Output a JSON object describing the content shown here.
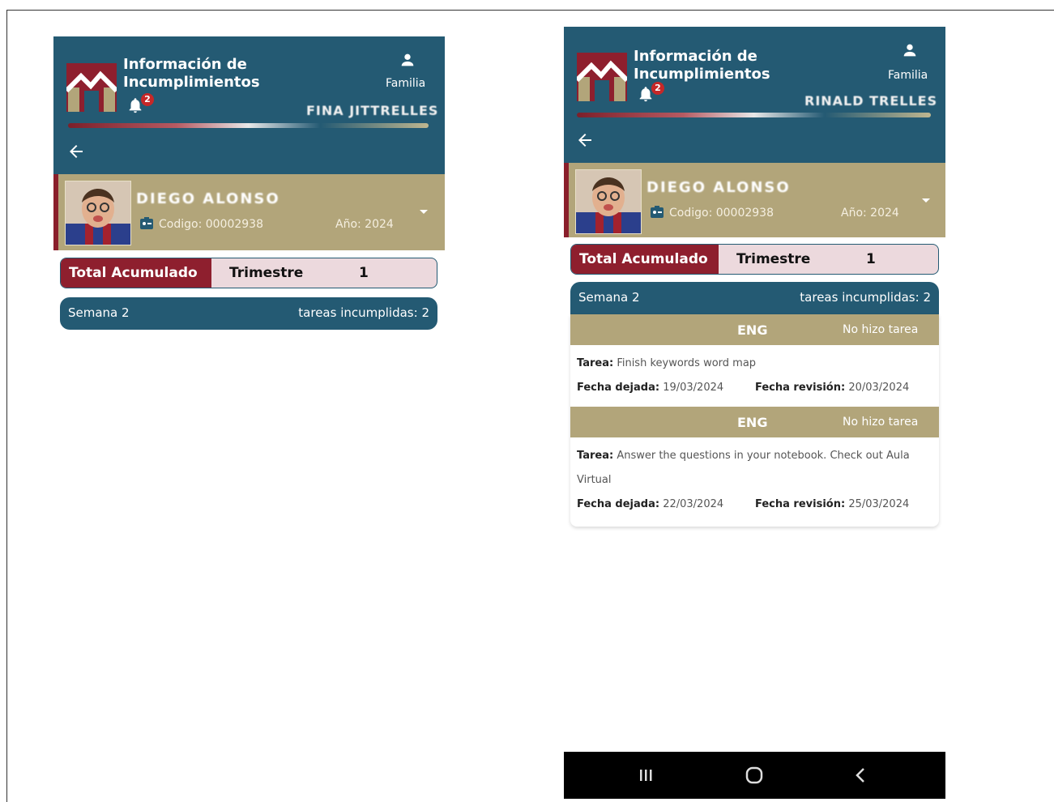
{
  "app": {
    "title": "Información de\nIncumplimientos",
    "notification_count": "2",
    "role": "Familia",
    "parent_name_left": "FINA JITTRELLES",
    "parent_name_right": "RINALD TRELLES"
  },
  "student": {
    "name": "DIEGO ALONSO",
    "code": "Codigo: 00002938",
    "year": "Año: 2024"
  },
  "tabs": {
    "total_label": "Total Acumulado",
    "period_label": "Trimestre",
    "period_value": "1"
  },
  "week": {
    "label": "Semana 2",
    "count_text": "tareas incumplidas: 2"
  },
  "tasks": [
    {
      "subject": "ENG",
      "status": "No hizo tarea",
      "task_label": "Tarea:",
      "task_text": "Finish keywords word map",
      "due_label": "Fecha dejada:",
      "due_date": "19/03/2024",
      "review_label": "Fecha revisión:",
      "review_date": "20/03/2024"
    },
    {
      "subject": "ENG",
      "status": "No hizo tarea",
      "task_label": "Tarea:",
      "task_text": "Answer the questions in your notebook. Check out Aula Virtual",
      "due_label": "Fecha dejada:",
      "due_date": "22/03/2024",
      "review_label": "Fecha revisión:",
      "review_date": "25/03/2024"
    }
  ],
  "colors": {
    "header": "#245a73",
    "student_band": "#b2a57a",
    "accent": "#8e1f2e",
    "tab_bg": "#ecd9dd"
  },
  "icons": {
    "logo": "school-logo-icon",
    "bell": "bell-icon",
    "user": "user-icon",
    "back": "arrow-left-icon",
    "id": "id-card-icon",
    "caret": "chevron-down-icon",
    "nav": [
      "recent-apps-icon",
      "home-icon",
      "back-nav-icon"
    ]
  }
}
